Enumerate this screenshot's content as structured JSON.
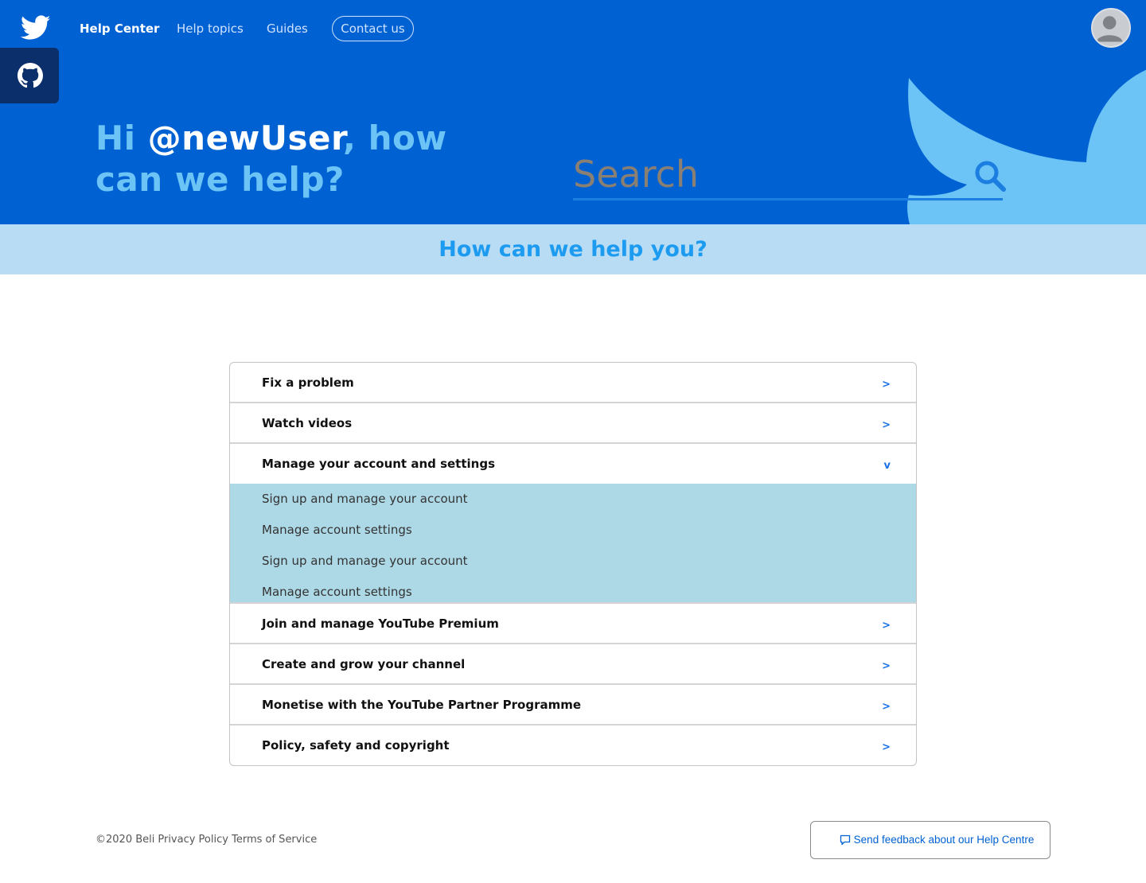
{
  "nav": {
    "help_center": "Help Center",
    "help_topics": "Help topics",
    "guides": "Guides",
    "contact_us": "Contact us"
  },
  "hero": {
    "greeting_hi": "Hi ",
    "greeting_user": "@newUser",
    "greeting_rest": ", how can we help?"
  },
  "search": {
    "placeholder": "Search"
  },
  "subbanner": {
    "title": "How can we help you?"
  },
  "accordion": {
    "items": [
      {
        "label": "Fix a problem",
        "chevron": ">"
      },
      {
        "label": "Watch videos",
        "chevron": ">"
      },
      {
        "label": "Manage your account and settings",
        "chevron": "v"
      },
      {
        "label": "Join and manage YouTube Premium",
        "chevron": ">"
      },
      {
        "label": "Create and grow your channel",
        "chevron": ">"
      },
      {
        "label": "Monetise with the YouTube Partner Programme",
        "chevron": ">"
      },
      {
        "label": "Policy, safety and copyright",
        "chevron": ">"
      }
    ],
    "expanded_sub_items": [
      "Sign up and manage your account",
      "Manage account settings",
      "Sign up and manage your account",
      "Manage account settings"
    ]
  },
  "footer": {
    "copyright": "©2020 Beli",
    "privacy": "Privacy Policy",
    "terms": "Terms of Service",
    "feedback": "Send feedback about our Help Centre"
  },
  "colors": {
    "hero_bg": "#0061d3",
    "accent_light": "#6cc3f5",
    "subbanner_bg": "#b8dcf4",
    "expanded_panel_bg": "#add8e6"
  }
}
